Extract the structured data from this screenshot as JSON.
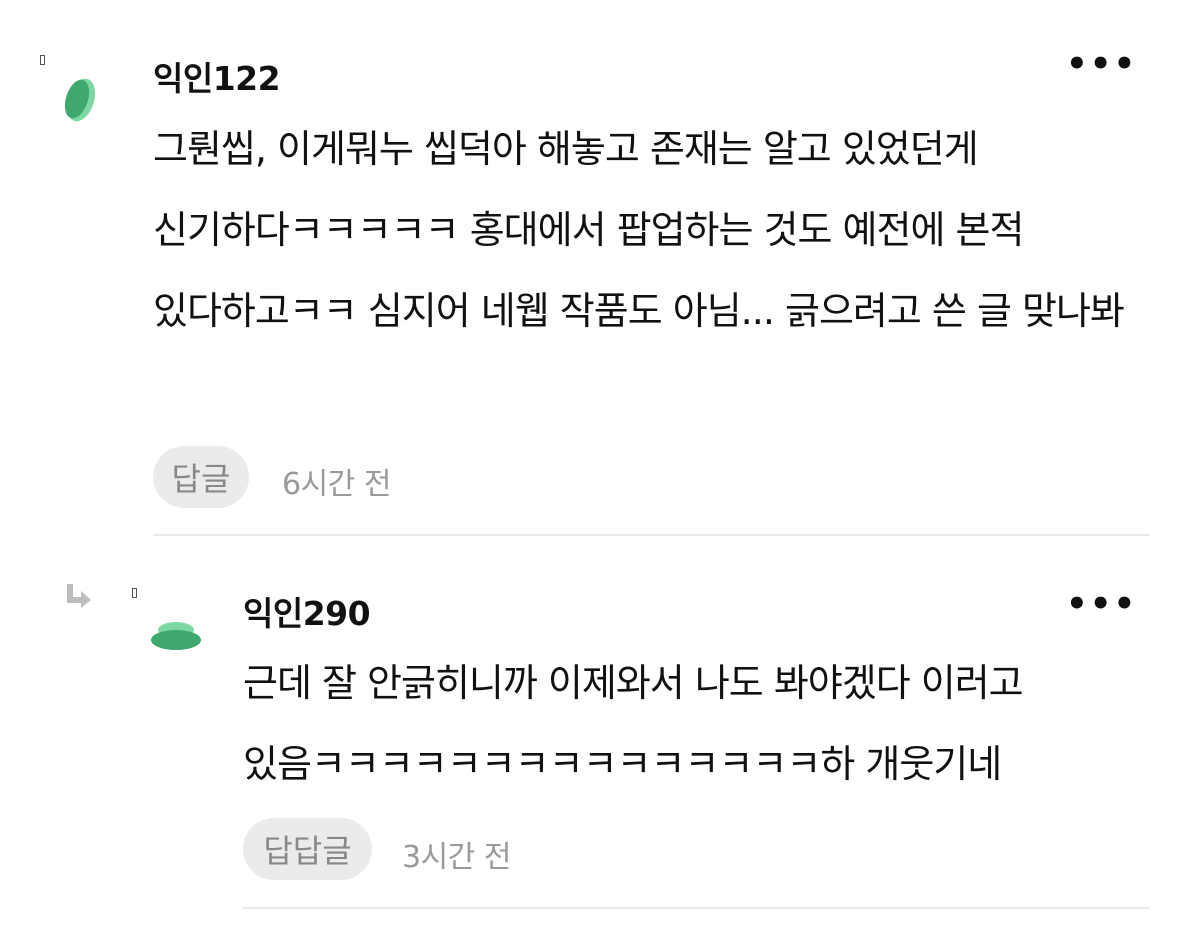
{
  "comments": [
    {
      "author": "익인122",
      "more_label": "•••",
      "text": "그뤈씹, 이게뭐누 씹덕아 해놓고 존재는 알고 있었던게 신기하다ㅋㅋㅋㅋㅋ 홍대에서 팝업하는 것도 예전에 본적 있다하고ㅋㅋ 심지어 네웹 작품도 아님... 긁으려고 쓴 글 맞나봐",
      "reply_label": "답글",
      "time": "6시간 전",
      "avatar_color": "#5cc48a"
    },
    {
      "author": "익인290",
      "more_label": "•••",
      "text": "근데 잘 안긁히니까 이제와서 나도 봐야겠다 이러고 있음ㅋㅋㅋㅋㅋㅋㅋㅋㅋㅋㅋㅋㅋㅋㅋ하 개웃기네",
      "reply_label": "답답글",
      "time": "3시간 전",
      "avatar_color": "#5cc48a"
    }
  ],
  "icons": {
    "reply_arrow": "reply-arrow-icon",
    "avatar": "avatar-blob-icon",
    "more": "more-options-icon"
  }
}
